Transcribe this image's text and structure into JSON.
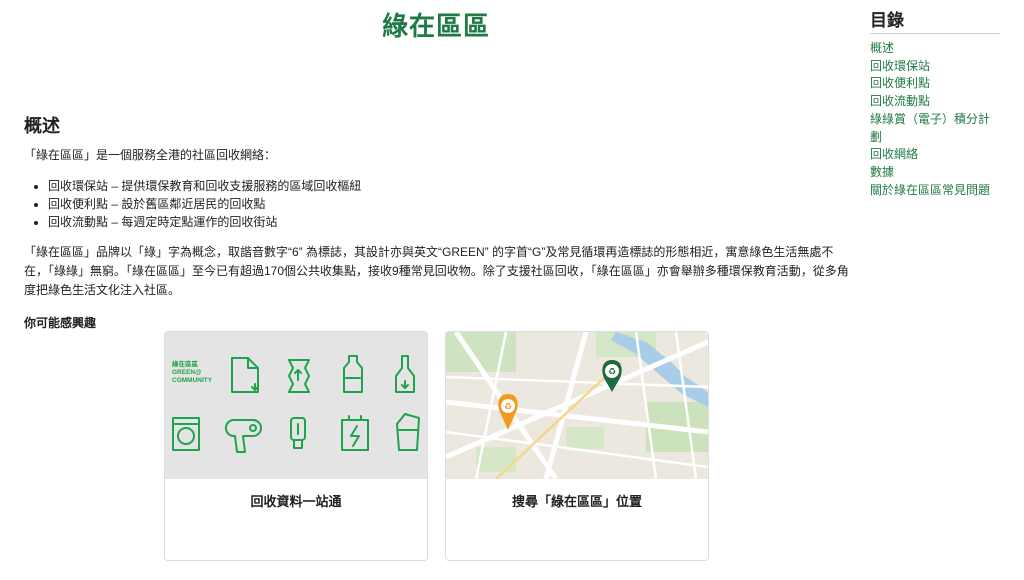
{
  "page": {
    "title": "綠在區區"
  },
  "toc": {
    "title": "目錄",
    "items": [
      {
        "label": "概述"
      },
      {
        "label": "回收環保站"
      },
      {
        "label": "回收便利點"
      },
      {
        "label": "回收流動點"
      },
      {
        "label": "綠綠賞（電子）積分計劃"
      },
      {
        "label": "回收網絡"
      },
      {
        "label": "數據"
      },
      {
        "label": "關於綠在區區常見問題"
      }
    ]
  },
  "overview": {
    "title": "概述",
    "intro": "「綠在區區」是一個服務全港的社區回收網絡：",
    "bullets": [
      "回收環保站 – 提供環保教育和回收支援服務的區域回收樞紐",
      "回收便利點 – 設於舊區鄰近居民的回收點",
      "回收流動點 – 每週定時定點運作的回收街站"
    ],
    "description": "「綠在區區」品牌以「綠」字為概念，取諧音數字“6” 為標誌，其設計亦與英文“GREEN” 的字首“G”及常見循環再造標誌的形態相近，寓意綠色生活無處不在，「綠綠」無窮。「綠在區區」至今已有超過170個公共收集點，接收9種常見回收物。除了支援社區回收，「綠在區區」亦會舉辦多種環保教育活動，從多角度把綠色生活文化注入社區。"
  },
  "interest": {
    "title": "你可能感興趣",
    "cards": [
      {
        "caption": "回收資料一站通",
        "logo_lines": [
          "綠在區區",
          "GREEN@",
          "COMMUNITY"
        ]
      },
      {
        "caption": "搜尋「綠在區區」位置"
      }
    ]
  },
  "colors": {
    "brand_green": "#1f7a45",
    "icon_green": "#20a34d",
    "pin_green": "#1d6b3c",
    "pin_orange": "#f39a1e"
  },
  "icons": [
    "paper-icon",
    "metal-can-icon",
    "plastic-bottle-icon",
    "glass-bottle-icon",
    "washing-machine-icon",
    "hair-dryer-icon",
    "light-bulb-icon",
    "battery-icon",
    "drink-carton-icon",
    "recycle-pin-icon"
  ]
}
